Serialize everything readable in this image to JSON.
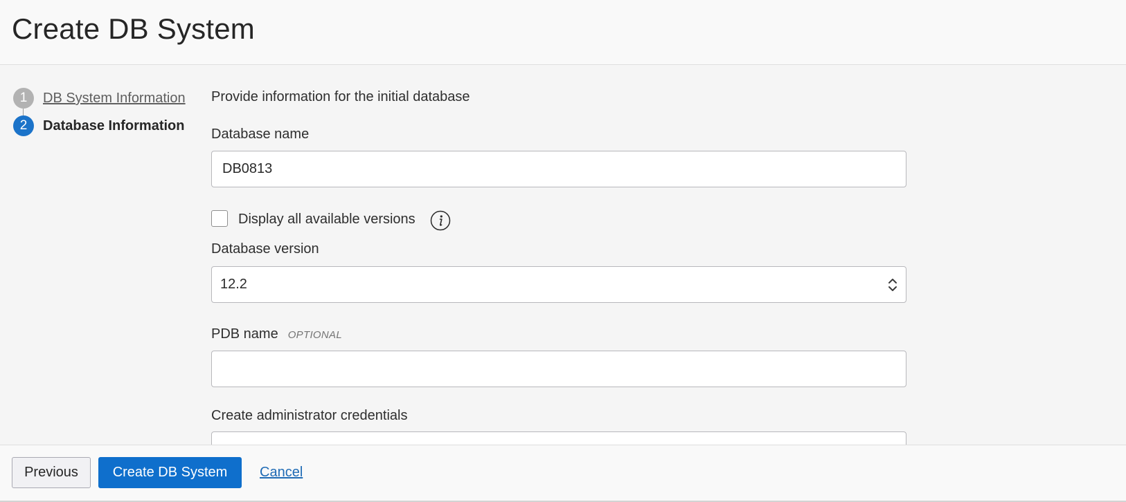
{
  "page": {
    "title": "Create DB System"
  },
  "steps": [
    {
      "number": "1",
      "label": "DB System Information",
      "state": "completed"
    },
    {
      "number": "2",
      "label": "Database Information",
      "state": "current"
    }
  ],
  "form": {
    "intro": "Provide information for the initial database",
    "database_name": {
      "label": "Database name",
      "value": "DB0813"
    },
    "display_versions": {
      "label": "Display all available versions",
      "checked": false
    },
    "database_version": {
      "label": "Database version",
      "value": "12.2"
    },
    "pdb_name": {
      "label": "PDB name",
      "optional": "OPTIONAL",
      "value": ""
    },
    "admin_credentials": {
      "label": "Create administrator credentials"
    }
  },
  "footer": {
    "previous_label": "Previous",
    "create_label": "Create DB System",
    "cancel_label": "Cancel"
  },
  "colors": {
    "primary": "#0f6fcc",
    "step_current": "#1b73c9",
    "step_completed": "#b2b2b2",
    "link": "#1f6bb5"
  }
}
